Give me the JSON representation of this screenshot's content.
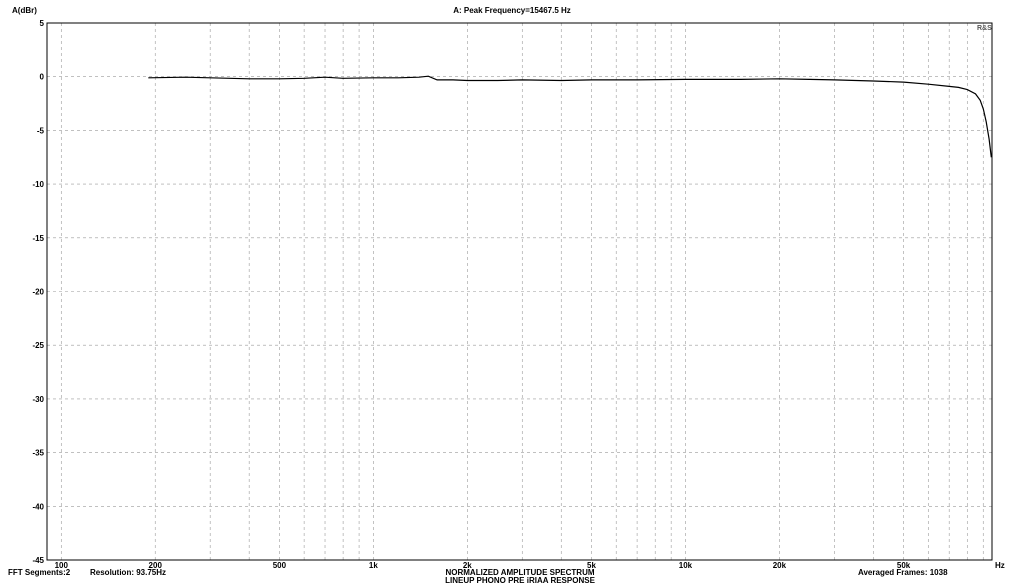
{
  "header": {
    "ylabel": "A(dBr)",
    "peak_text": "A: Peak Frequency=15467.5 Hz",
    "corner_mark": "R&S"
  },
  "footer": {
    "fft_segments": "FFT Segments:2",
    "resolution": "Resolution: 93.75Hz",
    "title_line1": "NORMALIZED AMPLITUDE SPECTRUM",
    "title_line2": "LINEUP PHONO PRE iRIAA RESPONSE",
    "averaged_frames": "Averaged Frames: 1038",
    "x_unit": "Hz"
  },
  "chart_data": {
    "type": "line",
    "xscale": "log",
    "xlim": [
      90,
      96000
    ],
    "ylim": [
      -45,
      5
    ],
    "ylabel": "A(dBr)",
    "xlabel": "Hz",
    "grid": true,
    "grid_style": "dashed",
    "line_color": "#000000",
    "x_ticks": [
      {
        "value": 100,
        "label": "100"
      },
      {
        "value": 200,
        "label": "200"
      },
      {
        "value": 500,
        "label": "500"
      },
      {
        "value": 1000,
        "label": "1k"
      },
      {
        "value": 2000,
        "label": "2k"
      },
      {
        "value": 5000,
        "label": "5k"
      },
      {
        "value": 10000,
        "label": "10k"
      },
      {
        "value": 20000,
        "label": "20k"
      },
      {
        "value": 50000,
        "label": "50k"
      }
    ],
    "y_ticks": [
      5,
      0,
      -5,
      -10,
      -15,
      -20,
      -25,
      -30,
      -35,
      -40,
      -45
    ],
    "series": [
      {
        "x": [
          190,
          250,
          300,
          400,
          500,
          600,
          700,
          800,
          1000,
          1200,
          1400,
          1500,
          1600,
          1800,
          2000,
          2500,
          3000,
          4000,
          5000,
          7000,
          10000,
          15000,
          20000,
          25000,
          30000,
          40000,
          50000,
          60000,
          70000,
          75000,
          80000,
          85000,
          88000,
          90000,
          92000,
          94000,
          95500
        ],
        "y": [
          -0.1,
          -0.05,
          -0.1,
          -0.2,
          -0.2,
          -0.15,
          -0.05,
          -0.15,
          -0.1,
          -0.1,
          -0.05,
          0.05,
          -0.3,
          -0.3,
          -0.35,
          -0.35,
          -0.3,
          -0.35,
          -0.3,
          -0.3,
          -0.25,
          -0.25,
          -0.2,
          -0.25,
          -0.3,
          -0.4,
          -0.5,
          -0.7,
          -0.9,
          -1.0,
          -1.2,
          -1.6,
          -2.2,
          -3.0,
          -4.2,
          -5.8,
          -7.5
        ]
      }
    ]
  }
}
